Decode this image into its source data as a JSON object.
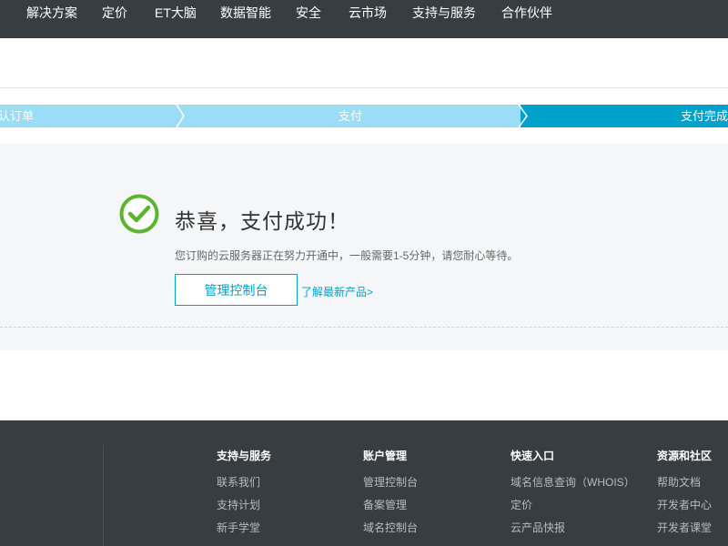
{
  "topnav": {
    "items": [
      "解决方案",
      "定价",
      "ET大脑",
      "数据智能",
      "安全",
      "云市场",
      "支持与服务",
      "合作伙伴"
    ]
  },
  "steps": {
    "step1": "认订单",
    "step2": "支付",
    "step3": "支付完成"
  },
  "result": {
    "title": "恭喜，支付成功！",
    "description": "您订购的云服务器正在努力开通中，一般需要1-5分钟，请您耐心等待。",
    "console_button": "管理控制台",
    "more_link": "了解最新产品>"
  },
  "footer": {
    "columns": [
      {
        "title": "支持与服务",
        "links": [
          "联系我们",
          "支持计划",
          "新手学堂"
        ]
      },
      {
        "title": "账户管理",
        "links": [
          "管理控制台",
          "备案管理",
          "域名控制台"
        ]
      },
      {
        "title": "快速入口",
        "links": [
          "域名信息查询（WHOIS）",
          "定价",
          "云产品快报"
        ]
      },
      {
        "title": "资源和社区",
        "links": [
          "帮助文档",
          "开发者中心",
          "开发者课堂"
        ]
      }
    ]
  },
  "colors": {
    "nav_bg": "#373d41",
    "step_light": "#9bdcf6",
    "step_active": "#00a2ca",
    "success_green": "#5cb531",
    "accent": "#00a2ca"
  }
}
